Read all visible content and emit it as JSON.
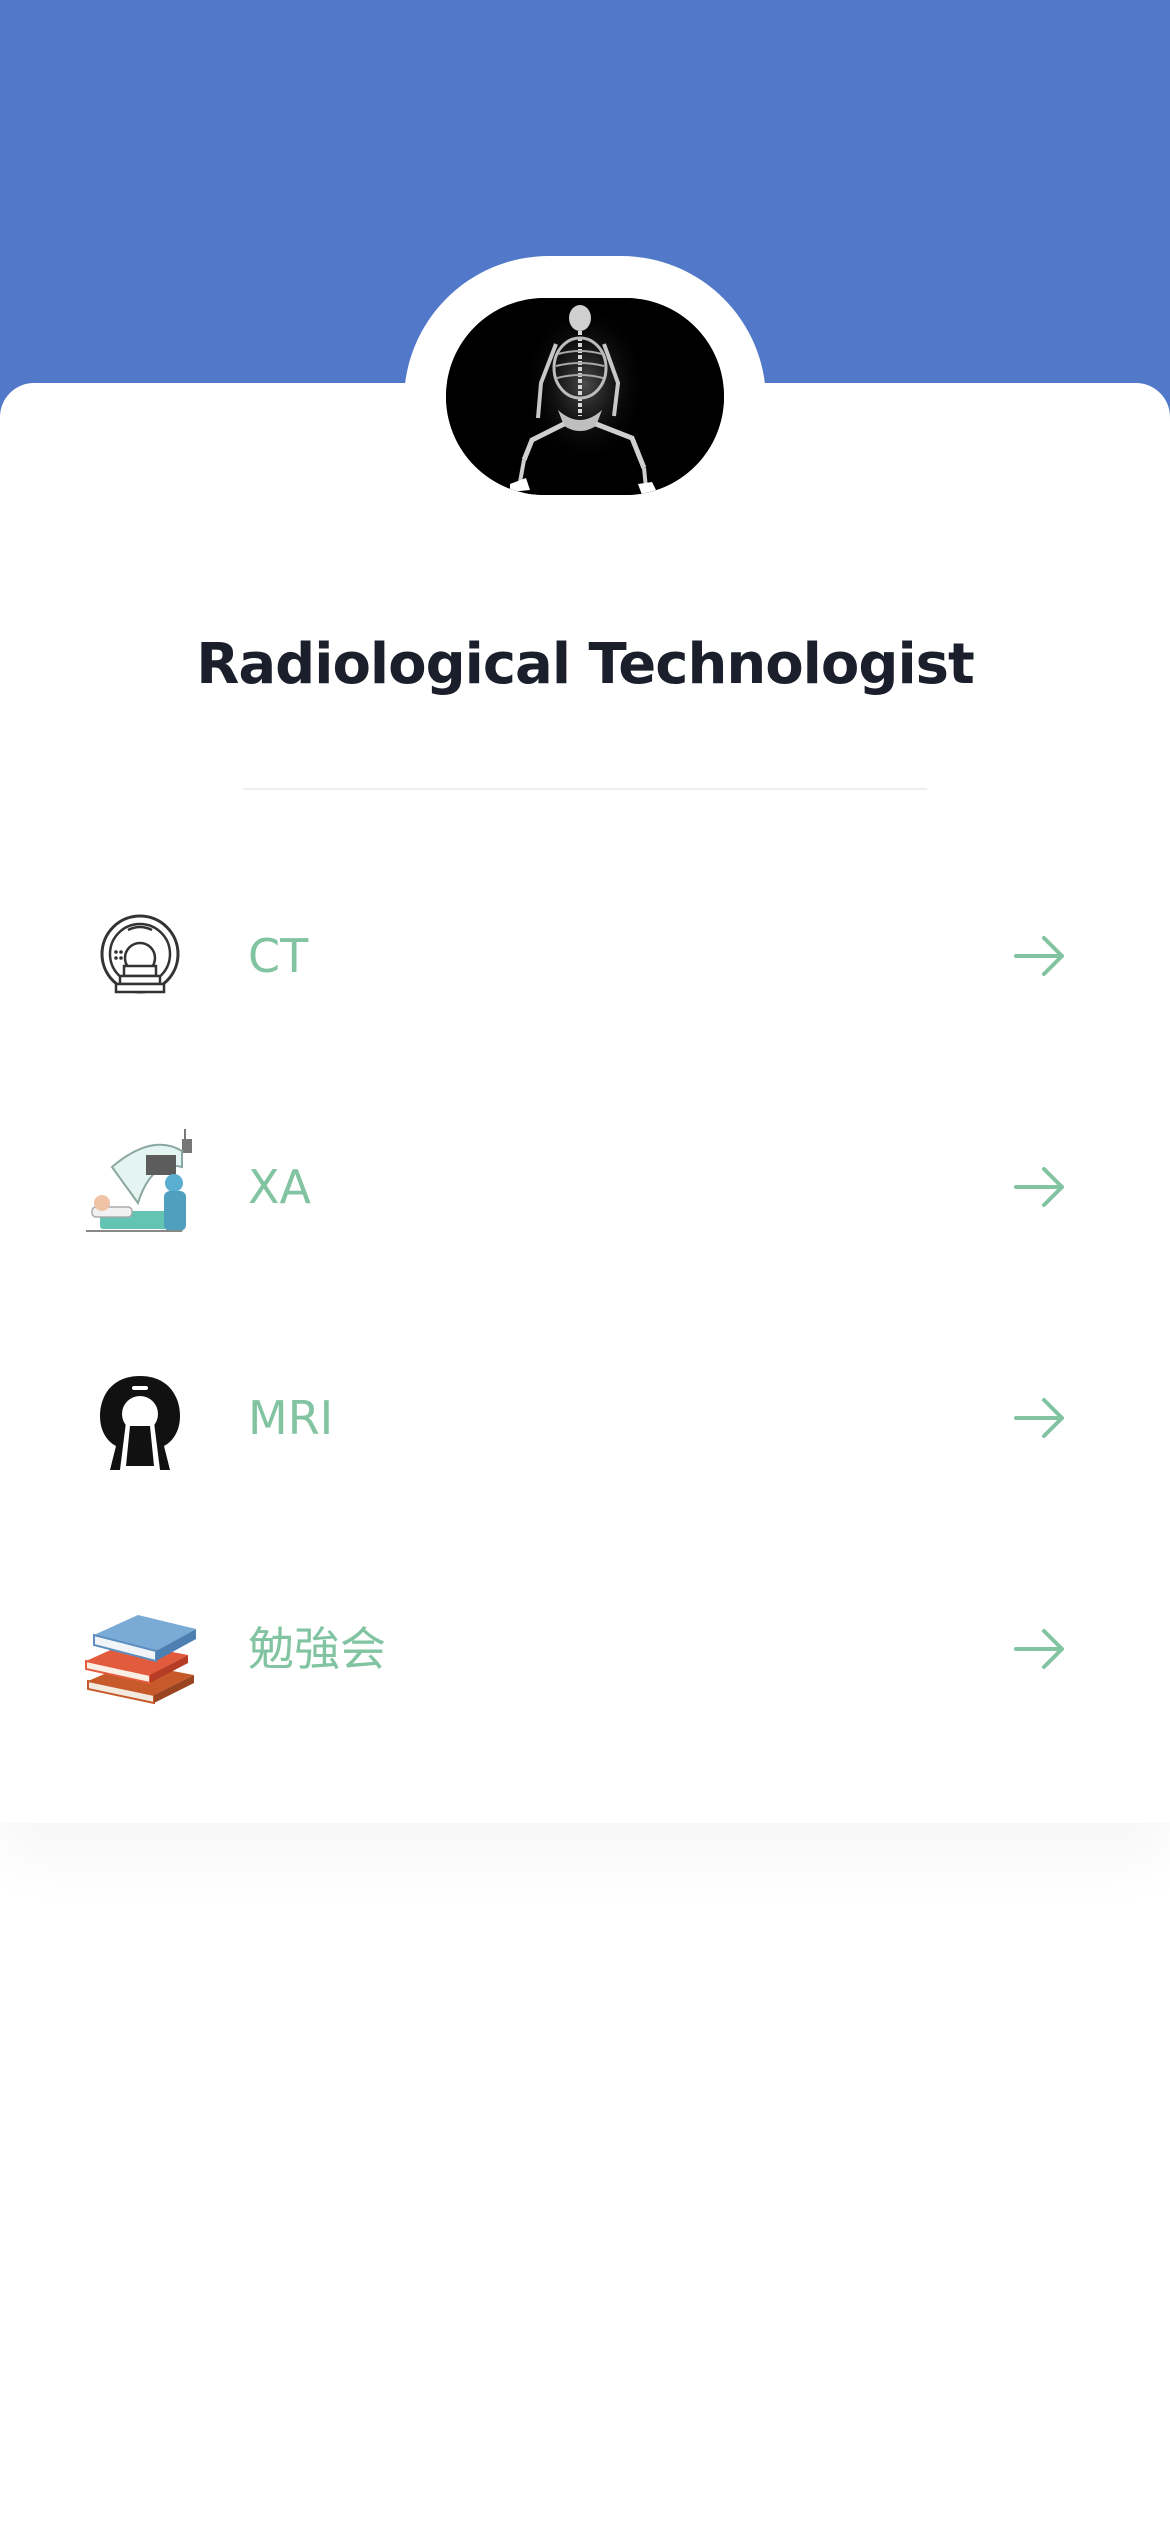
{
  "profile": {
    "title": "Radiological Technologist",
    "avatar_icon": "xray-skeleton-image"
  },
  "menu": [
    {
      "label": "CT",
      "icon": "ct-scanner-icon"
    },
    {
      "label": "XA",
      "icon": "angiography-icon"
    },
    {
      "label": "MRI",
      "icon": "mri-scanner-icon"
    },
    {
      "label": "勉強会",
      "icon": "books-icon"
    }
  ],
  "colors": {
    "header": "#5279c9",
    "accent": "#82c4a1",
    "title": "#1b1e2b"
  }
}
